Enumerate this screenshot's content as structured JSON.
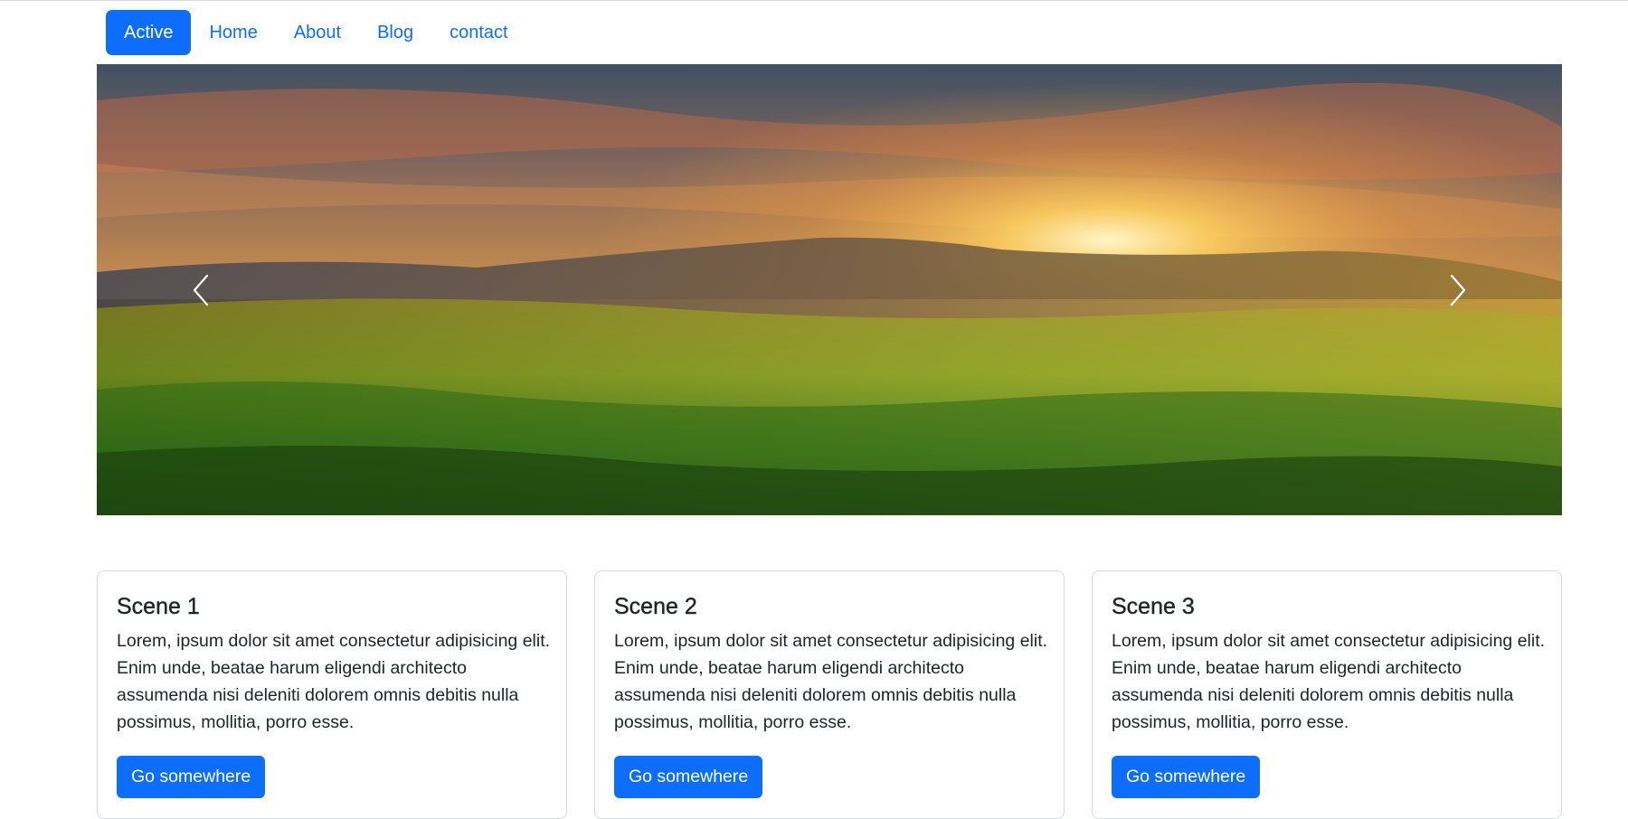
{
  "nav": {
    "items": [
      {
        "label": "Active",
        "active": true
      },
      {
        "label": "Home"
      },
      {
        "label": "About"
      },
      {
        "label": "Blog"
      },
      {
        "label": "contact"
      }
    ]
  },
  "carousel": {
    "prev_icon": "chevron-left-icon",
    "next_icon": "chevron-right-icon"
  },
  "cards": [
    {
      "title": "Scene 1",
      "text": "Lorem, ipsum dolor sit amet consectetur adipisicing elit. Enim unde, beatae harum eligendi architecto assumenda nisi deleniti dolorem omnis debitis nulla possimus, mollitia, porro esse.",
      "button": "Go somewhere"
    },
    {
      "title": "Scene 2",
      "text": "Lorem, ipsum dolor sit amet consectetur adipisicing elit. Enim unde, beatae harum eligendi architecto assumenda nisi deleniti dolorem omnis debitis nulla possimus, mollitia, porro esse.",
      "button": "Go somewhere"
    },
    {
      "title": "Scene 3",
      "text": "Lorem, ipsum dolor sit amet consectetur adipisicing elit. Enim unde, beatae harum eligendi architecto assumenda nisi deleniti dolorem omnis debitis nulla possimus, mollitia, porro esse.",
      "button": "Go somewhere"
    }
  ],
  "colors": {
    "primary": "#0d6efd",
    "text": "#212529",
    "card_border": "#d6d9dc"
  }
}
